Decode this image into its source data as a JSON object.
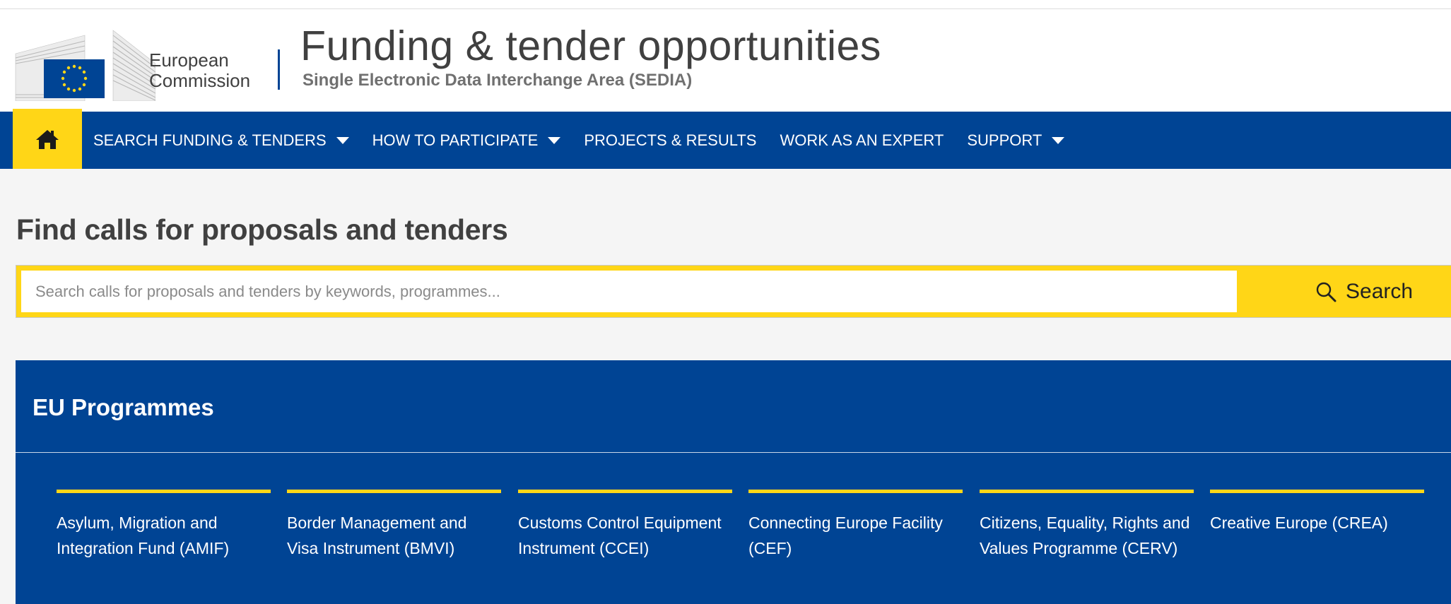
{
  "header": {
    "logo_text_line1": "European",
    "logo_text_line2": "Commission",
    "title": "Funding & tender opportunities",
    "subtitle": "Single Electronic Data Interchange Area (SEDIA)"
  },
  "nav": {
    "home_icon": "home-icon",
    "items": [
      {
        "label": "SEARCH FUNDING & TENDERS",
        "has_dropdown": true
      },
      {
        "label": "HOW TO PARTICIPATE",
        "has_dropdown": true
      },
      {
        "label": "PROJECTS & RESULTS",
        "has_dropdown": false
      },
      {
        "label": "WORK AS AN EXPERT",
        "has_dropdown": false
      },
      {
        "label": "SUPPORT",
        "has_dropdown": true
      }
    ]
  },
  "main": {
    "title": "Find calls for proposals and tenders"
  },
  "search": {
    "value": "",
    "placeholder": "Search calls for proposals and tenders by keywords, programmes...",
    "button_label": "Search",
    "button_icon": "search-icon"
  },
  "programmes": {
    "title": "EU Programmes",
    "items": [
      {
        "label": "Asylum, Migration and Integration Fund (AMIF)"
      },
      {
        "label": "Border Management and Visa Instrument (BMVI)"
      },
      {
        "label": "Customs Control Equipment Instrument (CCEI)"
      },
      {
        "label": "Connecting Europe Facility (CEF)"
      },
      {
        "label": "Citizens, Equality, Rights and Values Programme (CERV)"
      },
      {
        "label": "Creative Europe (CREA)"
      }
    ]
  },
  "colors": {
    "brand_blue": "#004494",
    "accent_yellow": "#FFD617",
    "text_dark": "#404040",
    "background": "#F5F5F5"
  }
}
